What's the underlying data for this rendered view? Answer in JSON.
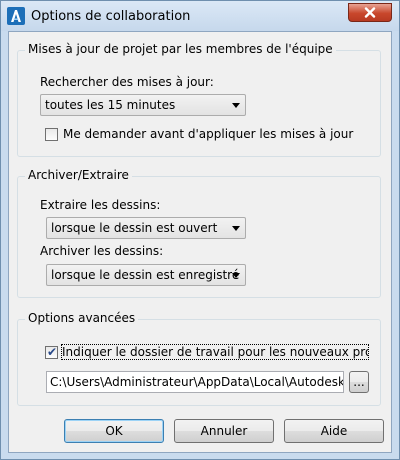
{
  "window": {
    "title": "Options de collaboration",
    "icon": "autocad-architecture-icon",
    "close_icon": "close-icon"
  },
  "updates_group": {
    "title": "Mises à jour de projet par les membres de l'équipe",
    "check_label": "Rechercher des mises à jour:",
    "check_value": "toutes les 15 minutes",
    "ask_checkbox_label": "Me demander avant d'appliquer les mises à jour",
    "ask_checked": false
  },
  "checkout_group": {
    "title": "Archiver/Extraire",
    "extract_label": "Extraire les dessins:",
    "extract_value": "lorsque le dessin est ouvert",
    "archive_label": "Archiver les dessins:",
    "archive_value": "lorsque le dessin est enregistré"
  },
  "advanced_group": {
    "title": "Options avancées",
    "workdir_label": "Indiquer le dossier de travail pour les nouveaux projets de",
    "workdir_checked": true,
    "path_value": "C:\\Users\\Administrateur\\AppData\\Local\\Autodesk\\Auto",
    "browse_label": "..."
  },
  "buttons": {
    "ok": "OK",
    "cancel": "Annuler",
    "help": "Aide"
  }
}
